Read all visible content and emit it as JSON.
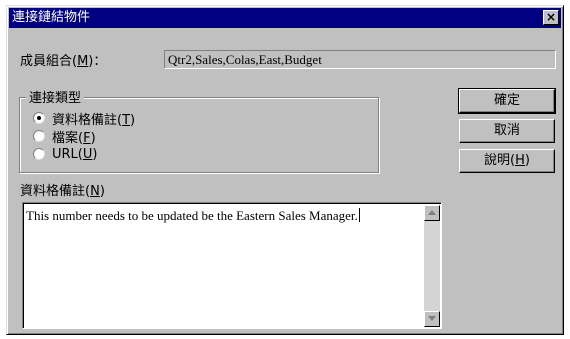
{
  "window": {
    "title": "連接鏈結物件",
    "close_glyph": "×",
    "close_icon": "close-icon"
  },
  "member": {
    "label_prefix": "成員組合(",
    "label_key": "M",
    "label_suffix": ")：",
    "value": "Qtr2,Sales,Colas,East,Budget"
  },
  "link_type": {
    "title": "連接類型",
    "options": [
      {
        "label_prefix": "資料格備註(",
        "label_key": "T",
        "label_suffix": ")",
        "checked": true
      },
      {
        "label_prefix": "檔案(",
        "label_key": "F",
        "label_suffix": ")",
        "checked": false
      },
      {
        "label_prefix": "URL(",
        "label_key": "U",
        "label_suffix": ")",
        "checked": false
      }
    ]
  },
  "buttons": {
    "ok": "確定",
    "cancel": "取消",
    "help_prefix": "說明(",
    "help_key": "H",
    "help_suffix": ")"
  },
  "note": {
    "label_prefix": "資料格備註(",
    "label_key": "N",
    "label_suffix": ")",
    "text": "This number needs to be updated be the Eastern Sales Manager."
  },
  "colors": {
    "face": "#c0c0c0",
    "titlebar": "#000080",
    "titlebar_text": "#ffffff"
  }
}
